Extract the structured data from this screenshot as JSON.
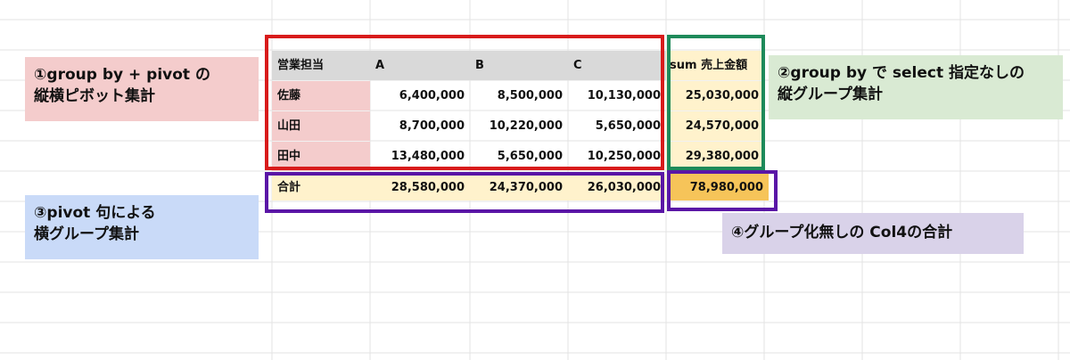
{
  "table": {
    "header": [
      "営業担当",
      "A",
      "B",
      "C",
      "sum 売上金額"
    ],
    "rows": [
      {
        "name": "佐藤",
        "a": "6,400,000",
        "b": "8,500,000",
        "c": "10,130,000",
        "sum": "25,030,000"
      },
      {
        "name": "山田",
        "a": "8,700,000",
        "b": "10,220,000",
        "c": "5,650,000",
        "sum": "24,570,000"
      },
      {
        "name": "田中",
        "a": "13,480,000",
        "b": "5,650,000",
        "c": "10,250,000",
        "sum": "29,380,000"
      }
    ],
    "total": {
      "label": "合計",
      "a": "28,580,000",
      "b": "24,370,000",
      "c": "26,030,000",
      "sum": "78,980,000"
    }
  },
  "notes": {
    "n1": "①group by + pivot の\n 縦横ピボット集計",
    "n2": "②group by で select 指定なしの\n 縦グループ集計",
    "n3": "③pivot 句による\n 横グループ集計",
    "n4": "④グループ化無しの Col4の合計"
  },
  "colors": {
    "header_gray": "#d9d9d9",
    "pink": "#f4cccc",
    "light_yellow": "#fff2cc",
    "orange": "#f6c459",
    "red_box": "#d81b1b",
    "green_box": "#1e8a5a",
    "purple_box": "#5a16a6",
    "note1_bg": "#f4cccc",
    "note2_bg": "#d9ead3",
    "note3_bg": "#c9daf8",
    "note4_bg": "#d9d2e9"
  }
}
